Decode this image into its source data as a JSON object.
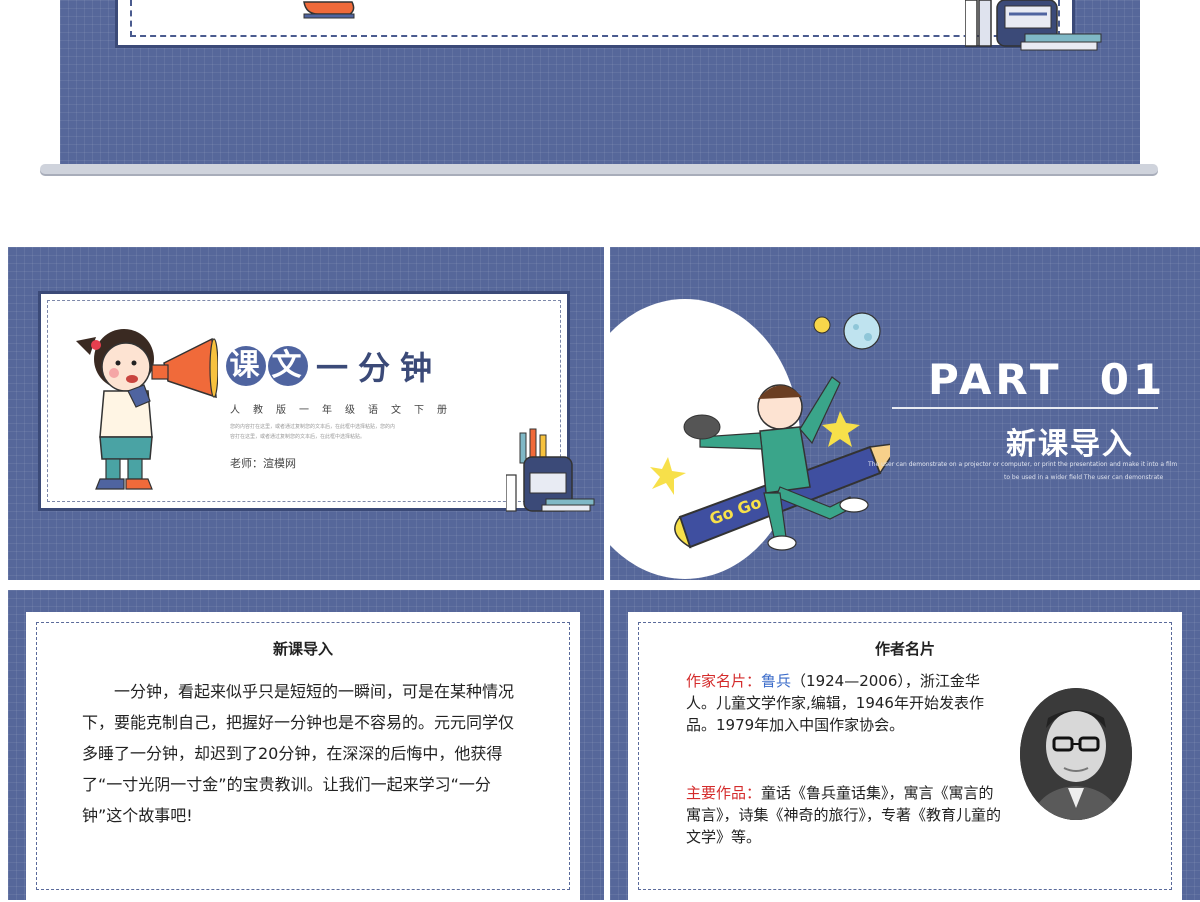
{
  "colors": {
    "slide_bg": "#56679a",
    "accent_red": "#d42b2b",
    "accent_blue": "#3a6bc9",
    "navy": "#3b4a78"
  },
  "slide2": {
    "title_circle_1": "课",
    "title_circle_2": "文",
    "title_rest": "一分钟",
    "subtitle": "人教版一年级语文下册",
    "fine_line_1": "您的内容打在这里，或者通过复制您的文本后，在此框中选择粘贴，您的内",
    "fine_line_2": "容打在这里，或者通过复制您的文本后，在此框中选择粘贴。",
    "teacher": "老师：渲模网"
  },
  "slide3": {
    "part": "PART  01",
    "subtitle": "新课导入",
    "english_1": "The user can demonstrate on a projector or computer, or print the presentation and make it into a film",
    "english_2": "to be used in a wider field The user can demonstrate",
    "badge_text": "Go Go"
  },
  "slide4": {
    "heading": "新课导入",
    "body": "一分钟，看起来似乎只是短短的一瞬间，可是在某种情况下，要能克制自己，把握好一分钟也是不容易的。元元同学仅多睡了一分钟，却迟到了20分钟，在深深的后悔中，他获得了“一寸光阴一寸金”的宝贵教训。让我们一起来学习“一分钟”这个故事吧!"
  },
  "slide5": {
    "heading": "作者名片",
    "bio_label": "作家名片：",
    "bio_name": "鲁兵",
    "bio_text": "（1924—2006），浙江金华人。儿童文学作家,编辑，1946年开始发表作品。1979年加入中国作家协会。",
    "works_label": "主要作品：",
    "works_text": "童话《鲁兵童话集》，寓言《寓言的寓言》，诗集《神奇的旅行》，专著《教育儿童的文学》等。"
  }
}
